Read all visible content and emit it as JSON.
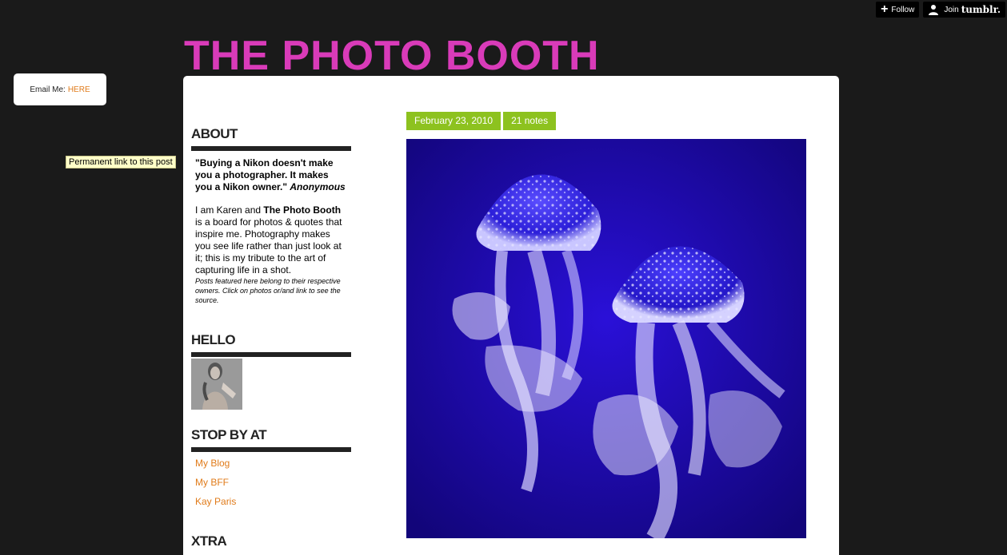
{
  "tumblr": {
    "follow_label": "Follow",
    "join_label": "Join",
    "brand": "tumblr."
  },
  "email": {
    "label": "Email Me:",
    "link": "HERE"
  },
  "tooltip": "Permanent link to this post",
  "site_title": "THE PHOTO BOOTH",
  "sidebar": {
    "about": {
      "heading": "ABOUT",
      "quote": "\"Buying a Nikon doesn't make you a photographer. It makes you a Nikon owner.\"",
      "quote_author": "Anonymous",
      "intro_prefix": "I am Karen and ",
      "intro_strong": "The Photo Booth",
      "intro_suffix": " is a board for photos & quotes that inspire me. Photography makes you see life rather than just look at it; this is my tribute to the art of capturing life in a shot.",
      "fine_print": "Posts featured here belong to their respective owners. Click on photos or/and link to see the source."
    },
    "hello": {
      "heading": "HELLO"
    },
    "stop_by": {
      "heading": "STOP BY AT",
      "links": [
        "My Blog",
        "My BFF",
        "Kay Paris"
      ]
    },
    "xtra": {
      "heading": "XTRA"
    }
  },
  "post": {
    "date": "February 23, 2010",
    "notes": "21 notes"
  },
  "colors": {
    "background": "#1a1a1a",
    "title": "#d93bb9",
    "accent_green": "#8dc21f",
    "link_orange": "#e07b1a"
  }
}
